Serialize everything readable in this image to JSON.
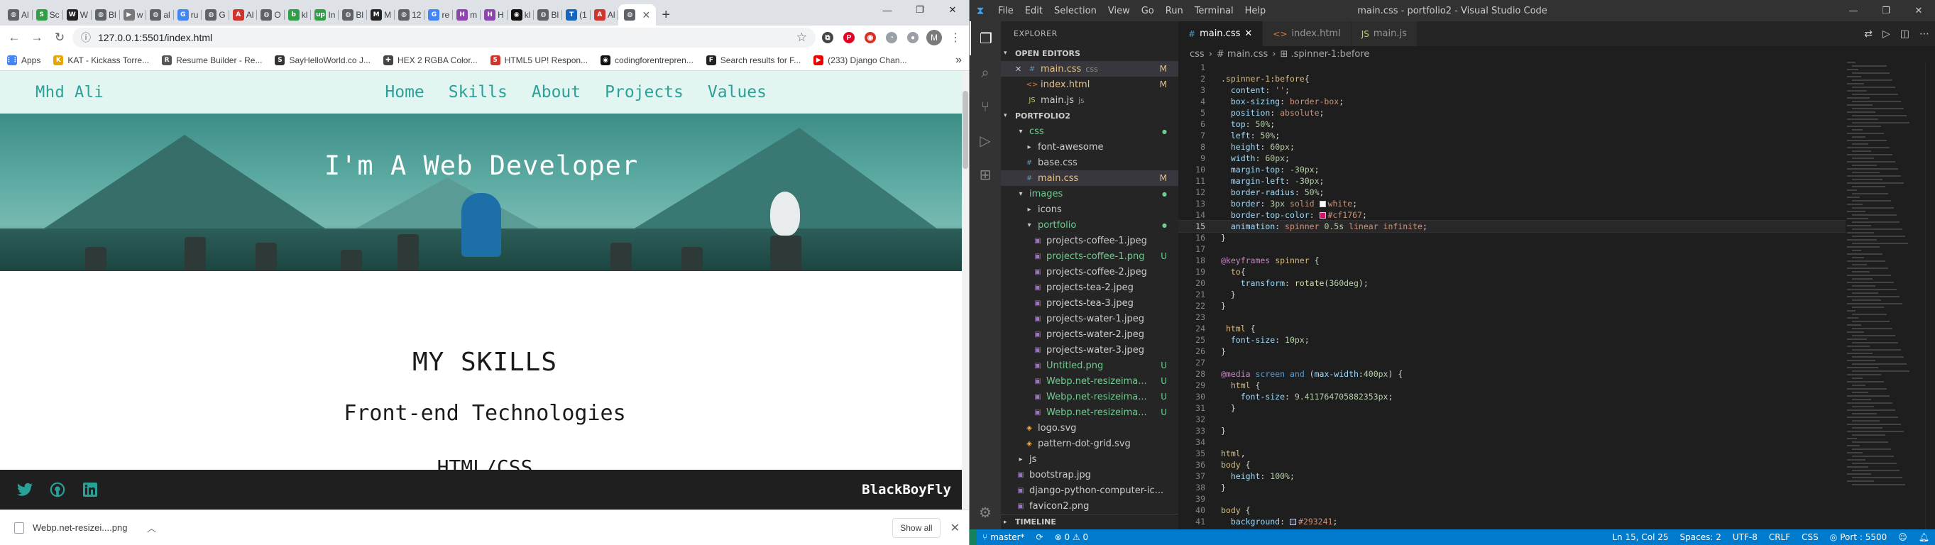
{
  "chrome": {
    "tabs": [
      {
        "label": "Al",
        "color": "#5f6368",
        "letter": "◍"
      },
      {
        "label": "Sc",
        "color": "#2f9e44",
        "letter": "S"
      },
      {
        "label": "W",
        "color": "#222",
        "letter": "W"
      },
      {
        "label": "Bl",
        "color": "#5f6368",
        "letter": "◍"
      },
      {
        "label": "w",
        "color": "#777",
        "letter": "▶"
      },
      {
        "label": "al",
        "color": "#5f6368",
        "letter": "◍"
      },
      {
        "label": "ru",
        "color": "#4285f4",
        "letter": "G"
      },
      {
        "label": "G",
        "color": "#5f6368",
        "letter": "◍"
      },
      {
        "label": "Al",
        "color": "#d0342c",
        "letter": "A"
      },
      {
        "label": "O",
        "color": "#5f6368",
        "letter": "◍"
      },
      {
        "label": "kl",
        "color": "#2f9e44",
        "letter": "b"
      },
      {
        "label": "In",
        "color": "#2f9e44",
        "letter": "up"
      },
      {
        "label": "Bl",
        "color": "#5f6368",
        "letter": "◍"
      },
      {
        "label": "M",
        "color": "#222",
        "letter": "M"
      },
      {
        "label": "12",
        "color": "#5f6368",
        "letter": "◍"
      },
      {
        "label": "re",
        "color": "#4285f4",
        "letter": "G"
      },
      {
        "label": "m",
        "color": "#8e44ad",
        "letter": "H"
      },
      {
        "label": "H",
        "color": "#8e44ad",
        "letter": "H"
      },
      {
        "label": "kl",
        "color": "#111",
        "letter": "◉"
      },
      {
        "label": "Bl",
        "color": "#5f6368",
        "letter": "◍"
      },
      {
        "label": "(1",
        "color": "#1565c0",
        "letter": "T"
      },
      {
        "label": "Al",
        "color": "#d0342c",
        "letter": "A"
      }
    ],
    "active_tab": {
      "label": "",
      "color": "#5f6368",
      "letter": "◍"
    },
    "url": "127.0.0.1:5501/index.html",
    "bookmarks": [
      {
        "label": "Apps",
        "color": "#4285f4",
        "letter": "⋮⋮"
      },
      {
        "label": "KAT - Kickass Torre...",
        "color": "#e8a400",
        "letter": "K"
      },
      {
        "label": "Resume Builder - Re...",
        "color": "#555",
        "letter": "R"
      },
      {
        "label": "SayHelloWorld.co J...",
        "color": "#333",
        "letter": "S"
      },
      {
        "label": "HEX 2 RGBA Color...",
        "color": "#444",
        "letter": "✚"
      },
      {
        "label": "HTML5 UP! Respon...",
        "color": "#d0342c",
        "letter": "5"
      },
      {
        "label": "codingforentrepren...",
        "color": "#111",
        "letter": "◉"
      },
      {
        "label": "Search results for F...",
        "color": "#222",
        "letter": "F"
      },
      {
        "label": "(233) Django Chan...",
        "color": "#e00",
        "letter": "▶"
      }
    ],
    "more_bookmarks": "»",
    "profile_letter": "M"
  },
  "site": {
    "brand": "Mhd Ali",
    "nav": [
      "Home",
      "Skills",
      "About",
      "Projects",
      "Values"
    ],
    "hero_title": "I'm A Web Developer",
    "skills_title": "MY SKILLS",
    "skills_sub": "Front-end Technologies",
    "skills_item": "HTML/CSS",
    "footer_sig": "BlackBoyFly"
  },
  "download": {
    "file": "Webp.net-resizei....png",
    "show_all": "Show all"
  },
  "vscode": {
    "title": "main.css - portfolio2 - Visual Studio Code",
    "menu": [
      "File",
      "Edit",
      "Selection",
      "View",
      "Go",
      "Run",
      "Terminal",
      "Help"
    ],
    "explorer_label": "EXPLORER",
    "open_editors_label": "OPEN EDITORS",
    "open_editors": [
      {
        "name": "main.css",
        "extra": "css",
        "badge": "M",
        "icon": "#",
        "color": "#e2c08d",
        "close": true
      },
      {
        "name": "index.html",
        "extra": "",
        "badge": "M",
        "icon": "<>",
        "color": "#e2c08d"
      },
      {
        "name": "main.js",
        "extra": "js",
        "badge": "",
        "icon": "JS",
        "color": "#ccc"
      }
    ],
    "project_label": "PORTFOLIO2",
    "tree": [
      {
        "name": "css",
        "indent": 1,
        "type": "folder-open",
        "color": "#73c991",
        "dot": true
      },
      {
        "name": "font-awesome",
        "indent": 2,
        "type": "folder",
        "color": "#ccc"
      },
      {
        "name": "base.css",
        "indent": 2,
        "type": "css",
        "color": "#ccc"
      },
      {
        "name": "main.css",
        "indent": 2,
        "type": "css",
        "color": "#e2c08d",
        "badge": "M",
        "sel": true
      },
      {
        "name": "images",
        "indent": 1,
        "type": "folder-open",
        "color": "#73c991",
        "dot": true
      },
      {
        "name": "icons",
        "indent": 2,
        "type": "folder",
        "color": "#ccc"
      },
      {
        "name": "portfolio",
        "indent": 2,
        "type": "folder-open",
        "color": "#73c991",
        "dot": true
      },
      {
        "name": "projects-coffee-1.jpeg",
        "indent": 3,
        "type": "img",
        "color": "#ccc"
      },
      {
        "name": "projects-coffee-1.png",
        "indent": 3,
        "type": "img",
        "color": "#73c991",
        "badge": "U"
      },
      {
        "name": "projects-coffee-2.jpeg",
        "indent": 3,
        "type": "img",
        "color": "#ccc"
      },
      {
        "name": "projects-tea-2.jpeg",
        "indent": 3,
        "type": "img",
        "color": "#ccc"
      },
      {
        "name": "projects-tea-3.jpeg",
        "indent": 3,
        "type": "img",
        "color": "#ccc"
      },
      {
        "name": "projects-water-1.jpeg",
        "indent": 3,
        "type": "img",
        "color": "#ccc"
      },
      {
        "name": "projects-water-2.jpeg",
        "indent": 3,
        "type": "img",
        "color": "#ccc"
      },
      {
        "name": "projects-water-3.jpeg",
        "indent": 3,
        "type": "img",
        "color": "#ccc"
      },
      {
        "name": "Untitled.png",
        "indent": 3,
        "type": "img",
        "color": "#73c991",
        "badge": "U"
      },
      {
        "name": "Webp.net-resizeima...",
        "indent": 3,
        "type": "img",
        "color": "#73c991",
        "badge": "U"
      },
      {
        "name": "Webp.net-resizeima...",
        "indent": 3,
        "type": "img",
        "color": "#73c991",
        "badge": "U"
      },
      {
        "name": "Webp.net-resizeima...",
        "indent": 3,
        "type": "img",
        "color": "#73c991",
        "badge": "U"
      },
      {
        "name": "logo.svg",
        "indent": 2,
        "type": "svg",
        "color": "#ccc"
      },
      {
        "name": "pattern-dot-grid.svg",
        "indent": 2,
        "type": "svg",
        "color": "#ccc"
      },
      {
        "name": "js",
        "indent": 1,
        "type": "folder",
        "color": "#ccc"
      },
      {
        "name": "bootstrap.jpg",
        "indent": 1,
        "type": "img",
        "color": "#ccc"
      },
      {
        "name": "django-python-computer-ic...",
        "indent": 1,
        "type": "img",
        "color": "#ccc"
      },
      {
        "name": "favicon2.png",
        "indent": 1,
        "type": "img",
        "color": "#ccc"
      }
    ],
    "timeline_label": "TIMELINE",
    "tabs": [
      {
        "name": "main.css",
        "icon": "#",
        "active": true
      },
      {
        "name": "index.html",
        "icon": "<>",
        "active": false
      },
      {
        "name": "main.js",
        "icon": "JS",
        "active": false
      }
    ],
    "breadcrumbs": [
      "css",
      "#  main.css",
      "⊞ .spinner-1:before"
    ],
    "code": [
      {
        "n": "1",
        "html": ""
      },
      {
        "n": "2",
        "html": "<span class='c-sel'>.spinner-1:before</span><span class='c-br'>{</span>",
        "cur": true
      },
      {
        "n": "3",
        "html": "  <span class='c-prop'>content</span>: <span class='c-val'>''</span>;"
      },
      {
        "n": "4",
        "html": "  <span class='c-prop'>box-sizing</span>: <span class='c-val'>border-box</span>;"
      },
      {
        "n": "5",
        "html": "  <span class='c-prop'>position</span>: <span class='c-val'>absolute</span>;"
      },
      {
        "n": "6",
        "html": "  <span class='c-prop'>top</span>: <span class='c-num'>50%</span>;"
      },
      {
        "n": "7",
        "html": "  <span class='c-prop'>left</span>: <span class='c-num'>50%</span>;"
      },
      {
        "n": "8",
        "html": "  <span class='c-prop'>height</span>: <span class='c-num'>60px</span>;"
      },
      {
        "n": "9",
        "html": "  <span class='c-prop'>width</span>: <span class='c-num'>60px</span>;"
      },
      {
        "n": "10",
        "html": "  <span class='c-prop'>margin-top</span>: <span class='c-num'>-30px</span>;"
      },
      {
        "n": "11",
        "html": "  <span class='c-prop'>margin-left</span>: <span class='c-num'>-30px</span>;"
      },
      {
        "n": "12",
        "html": "  <span class='c-prop'>border-radius</span>: <span class='c-num'>50%</span>;"
      },
      {
        "n": "13",
        "html": "  <span class='c-prop'>border</span>: <span class='c-num'>3px</span> <span class='c-val'>solid</span> <span class='sw' style='background:#fff'></span><span class='c-val'>white</span>;"
      },
      {
        "n": "14",
        "html": "  <span class='c-prop'>border-top-color</span>: <span class='sw' style='background:#cf1767'></span><span class='c-val'>#cf1767</span>;"
      },
      {
        "n": "15",
        "html": "  <span class='c-prop'>animation</span>: <span class='c-val'>spinner</span> <span class='c-num'>0.5s</span> <span class='c-val'>linear infinite</span>;",
        "curl": true
      },
      {
        "n": "16",
        "html": "<span class='c-br'>}</span>"
      },
      {
        "n": "17",
        "html": ""
      },
      {
        "n": "18",
        "html": "<span class='c-at'>@keyframes</span> <span class='c-sel'>spinner</span> <span class='c-br'>{</span>"
      },
      {
        "n": "19",
        "html": "  <span class='c-sel'>to</span><span class='c-br'>{</span>"
      },
      {
        "n": "20",
        "html": "    <span class='c-prop'>transform</span>: <span class='c-fn'>rotate</span>(<span class='c-num'>360deg</span>);"
      },
      {
        "n": "21",
        "html": "  <span class='c-br'>}</span>"
      },
      {
        "n": "22",
        "html": "<span class='c-br'>}</span>"
      },
      {
        "n": "23",
        "html": ""
      },
      {
        "n": "24",
        "html": " <span class='c-sel'>html</span> <span class='c-br'>{</span>"
      },
      {
        "n": "25",
        "html": "  <span class='c-prop'>font-size</span>: <span class='c-num'>10px</span>;"
      },
      {
        "n": "26",
        "html": "<span class='c-br'>}</span>"
      },
      {
        "n": "27",
        "html": ""
      },
      {
        "n": "28",
        "html": "<span class='c-at'>@media</span> <span class='c-kw'>screen</span> <span class='c-kw'>and</span> (<span class='c-prop'>max-width</span>:<span class='c-num'>400px</span>) <span class='c-br'>{</span>"
      },
      {
        "n": "29",
        "html": "  <span class='c-sel'>html</span> <span class='c-br'>{</span>"
      },
      {
        "n": "30",
        "html": "    <span class='c-prop'>font-size</span>: <span class='c-num'>9.411764705882353px</span>;"
      },
      {
        "n": "31",
        "html": "  <span class='c-br'>}</span>"
      },
      {
        "n": "32",
        "html": ""
      },
      {
        "n": "33",
        "html": "<span class='c-br'>}</span>"
      },
      {
        "n": "34",
        "html": ""
      },
      {
        "n": "35",
        "html": "<span class='c-sel'>html</span>,"
      },
      {
        "n": "36",
        "html": "<span class='c-sel'>body</span> <span class='c-br'>{</span>"
      },
      {
        "n": "37",
        "html": "  <span class='c-prop'>height</span>: <span class='c-num'>100%</span>;"
      },
      {
        "n": "38",
        "html": "<span class='c-br'>}</span>"
      },
      {
        "n": "39",
        "html": ""
      },
      {
        "n": "40",
        "html": "<span class='c-sel'>body</span> <span class='c-br'>{</span>"
      },
      {
        "n": "41",
        "html": "  <span class='c-prop'>background</span>: <span class='sw' style='background:#293241'></span><span class='c-val'>#293241</span>;"
      }
    ],
    "status": {
      "branch": "master*",
      "sync": "⟳",
      "problems": "⊗ 0 ⚠ 0",
      "position": "Ln 15, Col 25",
      "spaces": "Spaces: 2",
      "encoding": "UTF-8",
      "eol": "CRLF",
      "lang": "CSS",
      "port": "Port : 5500"
    }
  }
}
